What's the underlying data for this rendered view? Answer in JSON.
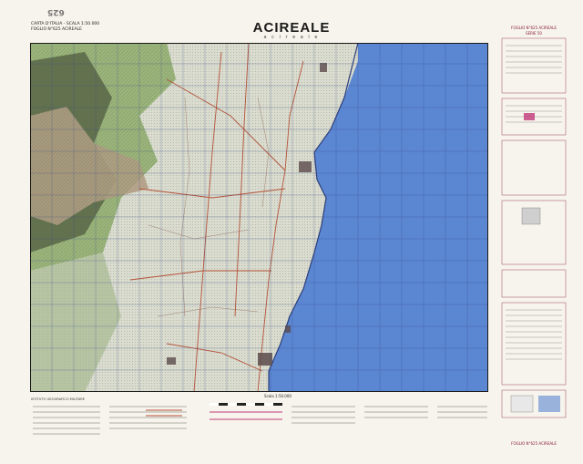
{
  "map": {
    "title": "ACIREALE",
    "subtitle": "a c i r e a l e",
    "sheet_number": "625",
    "series_line1": "CARTA D'ITALIA - SCALA 1:50.000",
    "series_line2": "FOGLIO N°625 ACIREALE"
  },
  "legend_right": {
    "heading_line1": "FOGLIO N°625 ACIREALE",
    "heading_line2": "SERIE 50"
  },
  "bottom": {
    "institute": "ISTITUTO GEOGRAFICO MILITARE",
    "scale": "Scala 1:50.000",
    "footer": "FOGLIO N°625 ACIREALE"
  },
  "colors": {
    "sea": "#5b86d2",
    "land": "#d9dccf",
    "relief_dark": "#4d5a3e",
    "vegetation": "#8fae6c",
    "lava": "#b09d83",
    "roads": "#b5523a",
    "magenta": "#c23a7a",
    "grid": "#3b4d8a"
  }
}
